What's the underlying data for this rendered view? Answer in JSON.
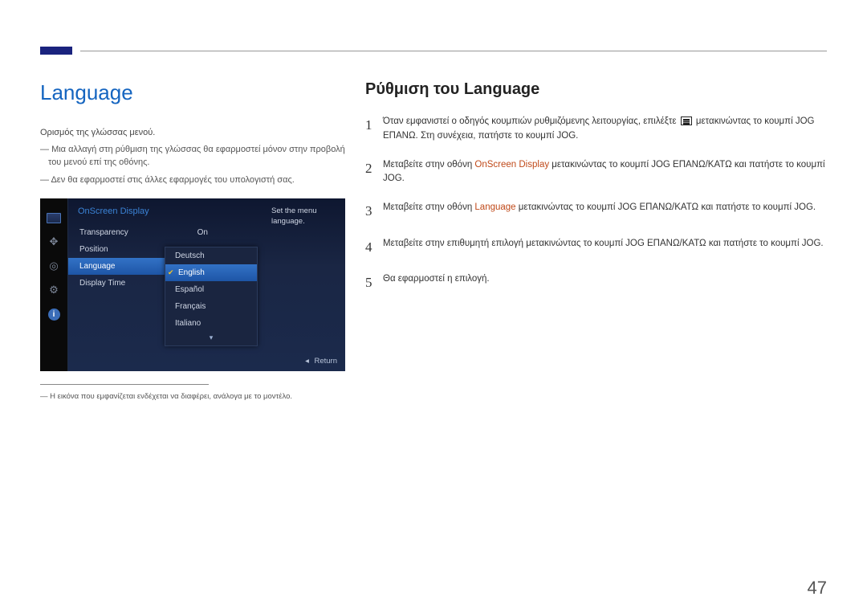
{
  "page_number": "47",
  "left": {
    "title": "Language",
    "subtitle": "Ορισμός της γλώσσας μενού.",
    "notes": [
      "Μια αλλαγή στη ρύθμιση της γλώσσας θα εφαρμοστεί μόνον στην προβολή του μενού επί της οθόνης.",
      "Δεν θα εφαρμοστεί στις άλλες εφαρμογές του υπολογιστή σας."
    ],
    "footnote": "― Η εικόνα που εμφανίζεται ενδέχεται να διαφέρει, ανάλογα με το μοντέλο."
  },
  "osd": {
    "title": "OnScreen Display",
    "desc": "Set the menu language.",
    "menu": [
      {
        "label": "Transparency",
        "value": "On",
        "selected": false
      },
      {
        "label": "Position",
        "value": "",
        "selected": false
      },
      {
        "label": "Language",
        "value": "",
        "selected": true
      },
      {
        "label": "Display Time",
        "value": "",
        "selected": false
      }
    ],
    "submenu": {
      "items": [
        "Deutsch",
        "English",
        "Español",
        "Français",
        "Italiano"
      ],
      "selected_index": 1
    },
    "return_label": "Return"
  },
  "right": {
    "heading": "Ρύθμιση του Language",
    "steps": [
      {
        "pre": "Όταν εμφανιστεί ο οδηγός κουμπιών ρυθμιζόμενης λειτουργίας, επιλέξτε ",
        "icon": true,
        "post": " μετακινώντας το κουμπί JOG ΕΠΑΝΩ. Στη συνέχεια, πατήστε το κουμπί JOG."
      },
      {
        "pre": "Μεταβείτε στην οθόνη ",
        "hl": "OnScreen Display",
        "post": " μετακινώντας το κουμπί JOG ΕΠΑΝΩ/ΚΑΤΩ και πατήστε το κουμπί JOG."
      },
      {
        "pre": "Μεταβείτε στην οθόνη ",
        "hl": "Language",
        "post": " μετακινώντας το κουμπί JOG ΕΠΑΝΩ/ΚΑΤΩ και πατήστε το κουμπί JOG."
      },
      {
        "pre": "Μεταβείτε στην επιθυμητή επιλογή μετακινώντας το κουμπί JOG ΕΠΑΝΩ/ΚΑΤΩ και πατήστε το κουμπί JOG.",
        "hl": "",
        "post": ""
      },
      {
        "pre": "Θα εφαρμοστεί η επιλογή.",
        "hl": "",
        "post": ""
      }
    ]
  }
}
